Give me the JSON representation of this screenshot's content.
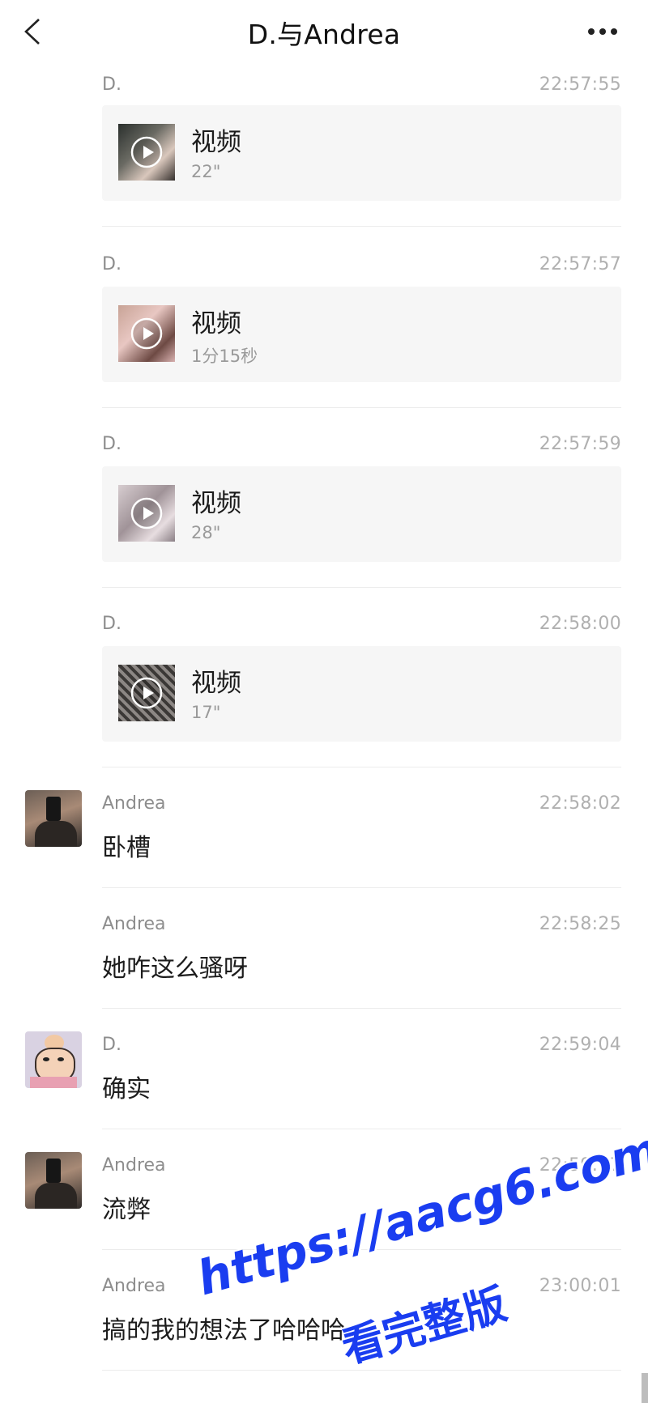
{
  "header": {
    "title": "D.与Andrea",
    "back_icon": "chevron-left-icon",
    "more_icon": "more-horizontal-icon"
  },
  "messages": [
    {
      "sender": "D.",
      "time": "22:57:55",
      "type": "video",
      "label": "视频",
      "duration": "22\""
    },
    {
      "sender": "D.",
      "time": "22:57:57",
      "type": "video",
      "label": "视频",
      "duration": "1分15秒"
    },
    {
      "sender": "D.",
      "time": "22:57:59",
      "type": "video",
      "label": "视频",
      "duration": "28\""
    },
    {
      "sender": "D.",
      "time": "22:58:00",
      "type": "video",
      "label": "视频",
      "duration": "17\""
    },
    {
      "sender": "Andrea",
      "time": "22:58:02",
      "type": "text",
      "text": "卧槽"
    },
    {
      "sender": "Andrea",
      "time": "22:58:25",
      "type": "text",
      "text": "她咋这么骚呀"
    },
    {
      "sender": "D.",
      "time": "22:59:04",
      "type": "text",
      "text": "确实"
    },
    {
      "sender": "Andrea",
      "time": "22:59:17",
      "type": "text",
      "text": "流弊"
    },
    {
      "sender": "Andrea",
      "time": "23:00:01",
      "type": "text",
      "text": "搞的我的想法了哈哈哈"
    }
  ],
  "watermark": {
    "url": "https://aacg6.com",
    "tagline": "看完整版",
    "color": "#1a3df0"
  }
}
